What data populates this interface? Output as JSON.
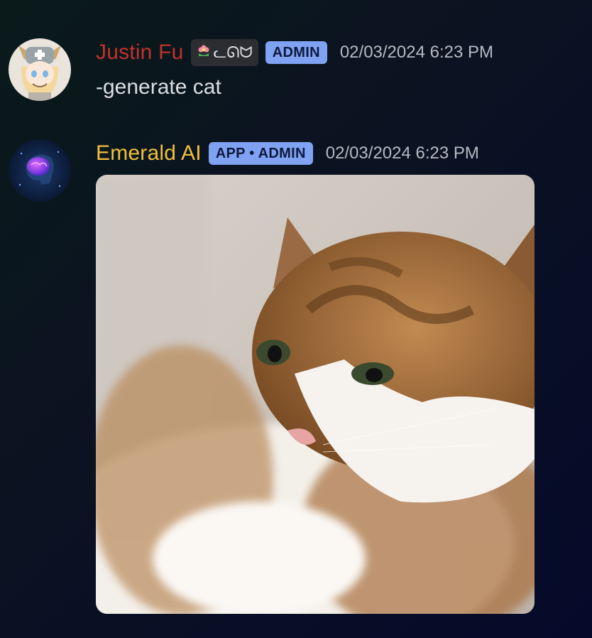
{
  "messages": [
    {
      "author": "Justin Fu",
      "author_color": "#c1322b",
      "guild_tag": "ᓚᘏᗢ",
      "guild_tag_icon": "flower-icon",
      "badge": "ADMIN",
      "timestamp": "02/03/2024 6:23 PM",
      "content": "-generate cat"
    },
    {
      "author": "Emerald AI",
      "author_color": "#f0c03d",
      "badge": "APP • ADMIN",
      "timestamp": "02/03/2024 6:23 PM",
      "attachment": "generated cat image"
    }
  ],
  "colors": {
    "badge_bg": "#7fa2f2",
    "background": "#0b1222"
  }
}
